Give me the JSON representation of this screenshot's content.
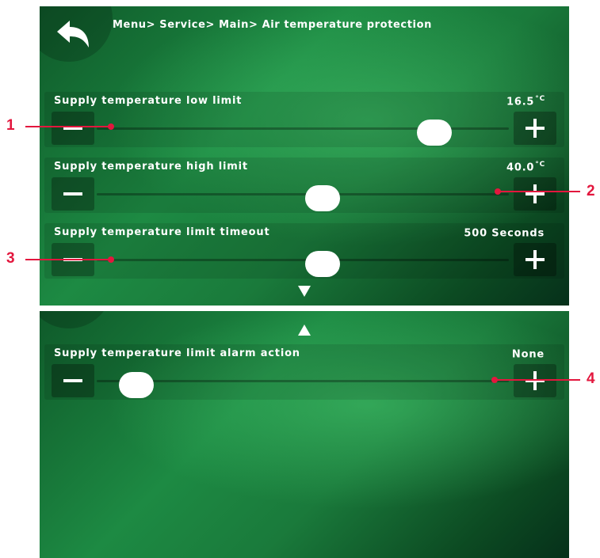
{
  "breadcrumb": "Menu> Service> Main> Air temperature protection",
  "icons": {
    "back": "back-arrow-icon",
    "minus": "minus-icon",
    "plus": "plus-icon",
    "scroll_down": "triangle-down-icon",
    "scroll_up": "triangle-up-icon"
  },
  "settings": [
    {
      "label": "Supply temperature low limit",
      "value": "16.5",
      "unit": "°C",
      "slider_level": 0.85
    },
    {
      "label": "Supply temperature high limit",
      "value": "40.0",
      "unit": "°C",
      "slider_level": 0.55
    },
    {
      "label": "Supply temperature limit timeout",
      "value": "500 Seconds",
      "unit": "",
      "slider_level": 0.55
    },
    {
      "label": "Supply temperature limit alarm action",
      "value": "None",
      "unit": "",
      "slider_level": 0.05
    }
  ],
  "callouts": [
    "1",
    "2",
    "3",
    "4"
  ],
  "colors": {
    "accent": "#e3173e",
    "background": "#1d8a43",
    "thumb": "#ffffff"
  }
}
